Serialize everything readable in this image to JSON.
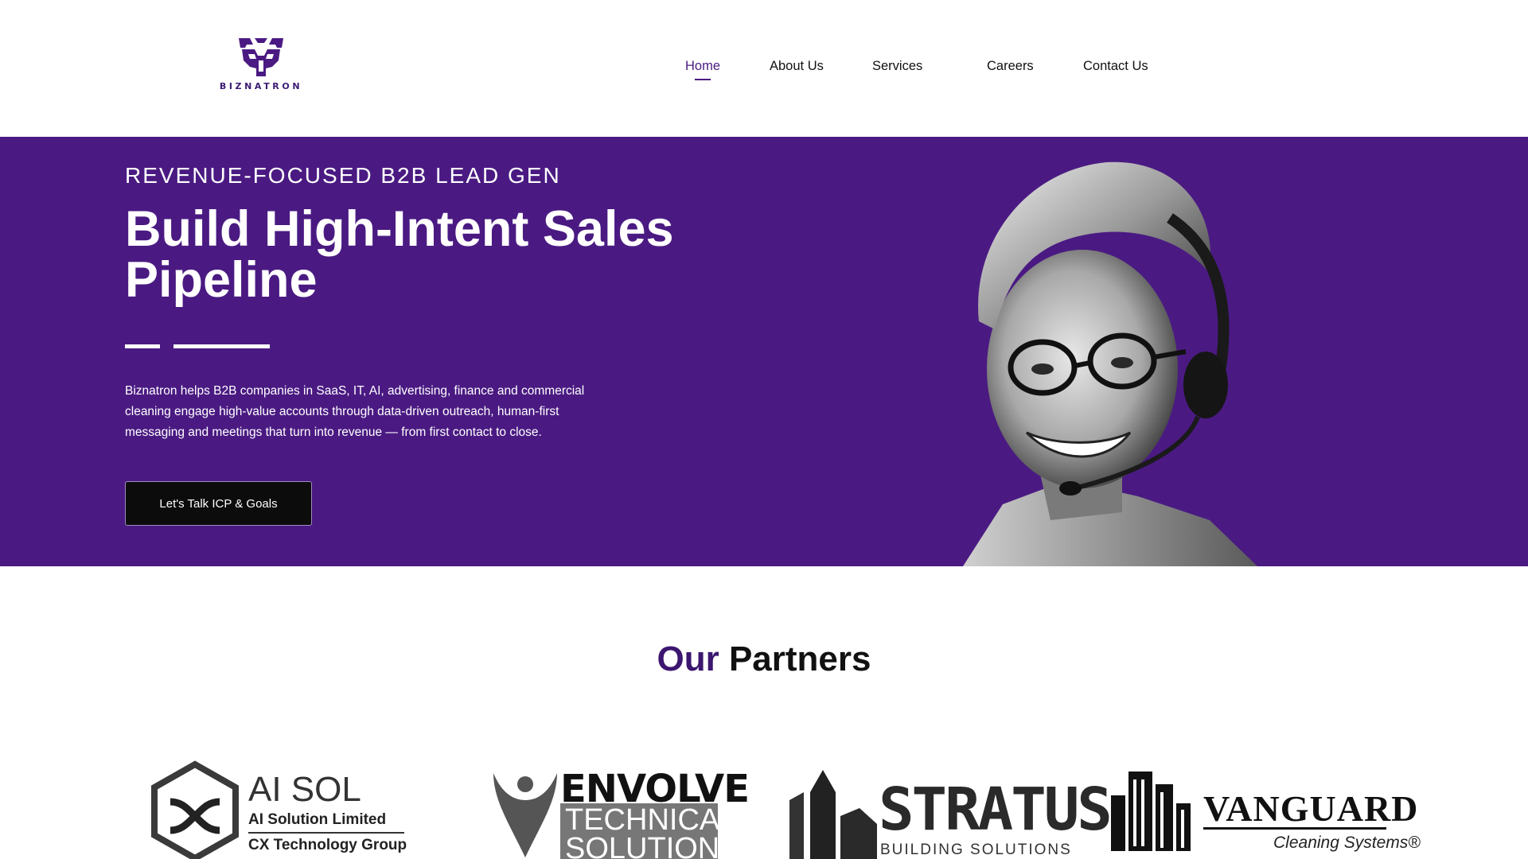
{
  "brand": {
    "name": "BIZNATRON",
    "accent_color": "#4a1a82",
    "logo_icon": "robot-mask-icon"
  },
  "nav": {
    "items": [
      {
        "label": "Home",
        "active": true
      },
      {
        "label": "About Us",
        "active": false
      },
      {
        "label": "Services",
        "active": false
      },
      {
        "label": "Careers",
        "active": false
      },
      {
        "label": "Contact Us",
        "active": false
      }
    ]
  },
  "hero": {
    "eyebrow": "REVENUE-FOCUSED B2B LEAD GEN",
    "title": "Build High-Intent Sales Pipeline",
    "description": "Biznatron helps B2B companies in SaaS, IT, AI, advertising, finance and commercial cleaning engage high-value accounts through data-driven outreach, human-first messaging and meetings that turn into revenue — from first contact to close.",
    "cta_label": "Let's Talk ICP & Goals",
    "background_color": "#4a1a82",
    "image": "headset-agent-portrait"
  },
  "partners": {
    "title_accent": "Our",
    "title_rest": "Partners",
    "logos": [
      {
        "name": "AI SOL",
        "line1": "AI Solution Limited",
        "line2": "CX Technology Group",
        "icon": "hexagon-x-icon"
      },
      {
        "name": "ENVOLVE",
        "line1": "TECHNICAL",
        "line2": "SOLUTIONS",
        "icon": "location-pin-icon"
      },
      {
        "name": "STRATUS",
        "line1": "BUILDING SOLUTIONS",
        "icon": "tower-icon"
      },
      {
        "name": "VANGUARD",
        "line1": "Cleaning Systems®",
        "icon": "buildings-icon"
      }
    ]
  }
}
